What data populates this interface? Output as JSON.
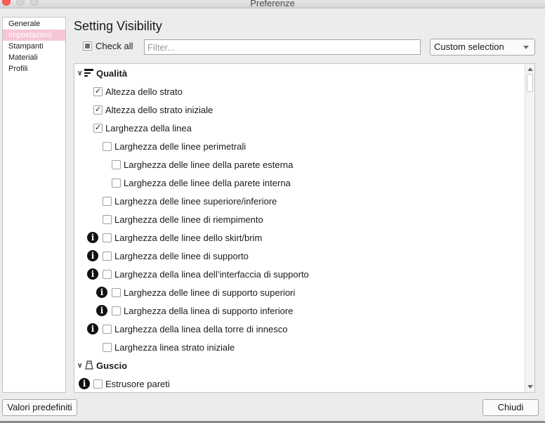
{
  "window": {
    "title": "Preferenze"
  },
  "sidebar": {
    "items": [
      {
        "label": "Generale",
        "active": false
      },
      {
        "label": "Impostazioni",
        "active": true
      },
      {
        "label": "Stampanti",
        "active": false
      },
      {
        "label": "Materiali",
        "active": false
      },
      {
        "label": "Profili",
        "active": false
      }
    ]
  },
  "header": {
    "title": "Setting Visibility"
  },
  "toolbar": {
    "check_all_label": "Check all",
    "check_all_state": "partial",
    "filter_placeholder": "Filter...",
    "filter_value": "",
    "preset_dropdown": "Custom selection"
  },
  "settings": {
    "categories": [
      {
        "label": "Qualità",
        "icon": "quality-icon",
        "expanded": true
      },
      {
        "label": "Guscio",
        "icon": "shell-icon",
        "expanded": true
      }
    ],
    "items": [
      {
        "label": "Altezza dello strato",
        "checked": true,
        "info": false,
        "depth": 0
      },
      {
        "label": "Altezza dello strato iniziale",
        "checked": true,
        "info": false,
        "depth": 0
      },
      {
        "label": "Larghezza della linea",
        "checked": true,
        "info": false,
        "depth": 0
      },
      {
        "label": "Larghezza delle linee perimetrali",
        "checked": false,
        "info": false,
        "depth": 1
      },
      {
        "label": "Larghezza delle linee della parete esterna",
        "checked": false,
        "info": false,
        "depth": 2
      },
      {
        "label": "Larghezza delle linee della parete interna",
        "checked": false,
        "info": false,
        "depth": 2
      },
      {
        "label": "Larghezza delle linee superiore/inferiore",
        "checked": false,
        "info": false,
        "depth": 1
      },
      {
        "label": "Larghezza delle linee di riempimento",
        "checked": false,
        "info": false,
        "depth": 1
      },
      {
        "label": "Larghezza delle linee dello skirt/brim",
        "checked": false,
        "info": true,
        "depth": 1
      },
      {
        "label": "Larghezza delle linee di supporto",
        "checked": false,
        "info": true,
        "depth": 1
      },
      {
        "label": "Larghezza della linea dell’interfaccia di supporto",
        "checked": false,
        "info": true,
        "depth": 1
      },
      {
        "label": "Larghezza delle linee di supporto superiori",
        "checked": false,
        "info": true,
        "depth": 2
      },
      {
        "label": "Larghezza della linea di supporto inferiore",
        "checked": false,
        "info": true,
        "depth": 2
      },
      {
        "label": "Larghezza della linea della torre di innesco",
        "checked": false,
        "info": true,
        "depth": 1
      },
      {
        "label": "Larghezza linea strato iniziale",
        "checked": false,
        "info": false,
        "depth": 1
      },
      {
        "label": "Estrusore pareti",
        "checked": false,
        "info": true,
        "depth": 0
      }
    ]
  },
  "footer": {
    "defaults_button": "Valori predefiniti",
    "close_button": "Chiudi"
  }
}
